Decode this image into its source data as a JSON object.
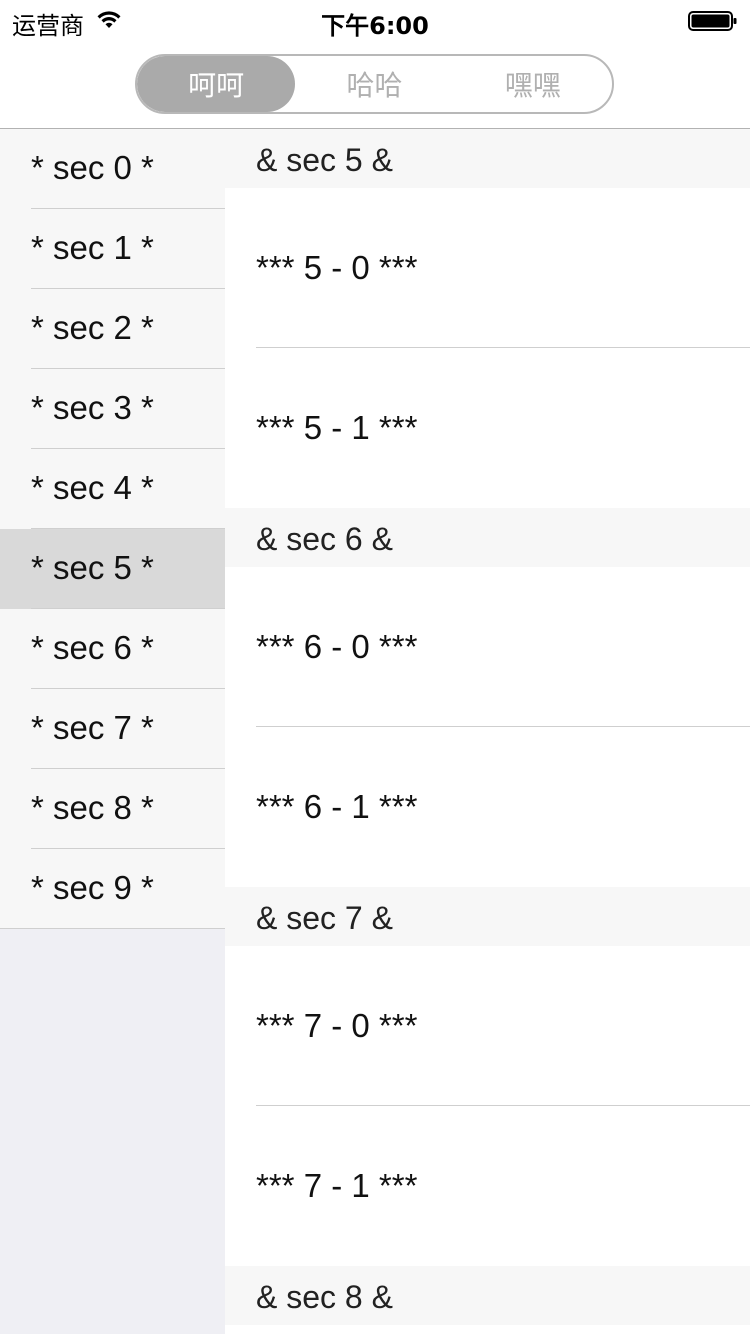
{
  "status": {
    "carrier": "运营商",
    "time": "下午6:00"
  },
  "segments": {
    "items": [
      {
        "label": "呵呵"
      },
      {
        "label": "哈哈"
      },
      {
        "label": "嘿嘿"
      }
    ],
    "selected_index": 0
  },
  "sidebar": {
    "items": [
      {
        "label": "* sec 0 *"
      },
      {
        "label": "* sec 1 *"
      },
      {
        "label": "* sec 2 *"
      },
      {
        "label": "* sec 3 *"
      },
      {
        "label": "* sec 4 *"
      },
      {
        "label": "* sec 5 *"
      },
      {
        "label": "* sec 6 *"
      },
      {
        "label": "* sec 7 *"
      },
      {
        "label": "* sec 8 *"
      },
      {
        "label": "* sec 9 *"
      }
    ],
    "selected_index": 5
  },
  "content": {
    "sections": [
      {
        "header": "& sec 5 &",
        "rows": [
          "*** 5 - 0 ***",
          "*** 5 - 1 ***"
        ]
      },
      {
        "header": "& sec 6 &",
        "rows": [
          "*** 6 - 0 ***",
          "*** 6 - 1 ***"
        ]
      },
      {
        "header": "& sec 7 &",
        "rows": [
          "*** 7 - 0 ***",
          "*** 7 - 1 ***"
        ]
      },
      {
        "header": "& sec 8 &",
        "rows": []
      }
    ]
  },
  "colors": {
    "segment_active_bg": "#aaaaaa",
    "segment_inactive_text": "#b0b0b0",
    "sidebar_selected_bg": "#d9d9d9",
    "sidebar_bg": "#f7f7f7",
    "sidebar_empty_bg": "#efeff4",
    "section_header_bg": "#f7f7f7"
  }
}
